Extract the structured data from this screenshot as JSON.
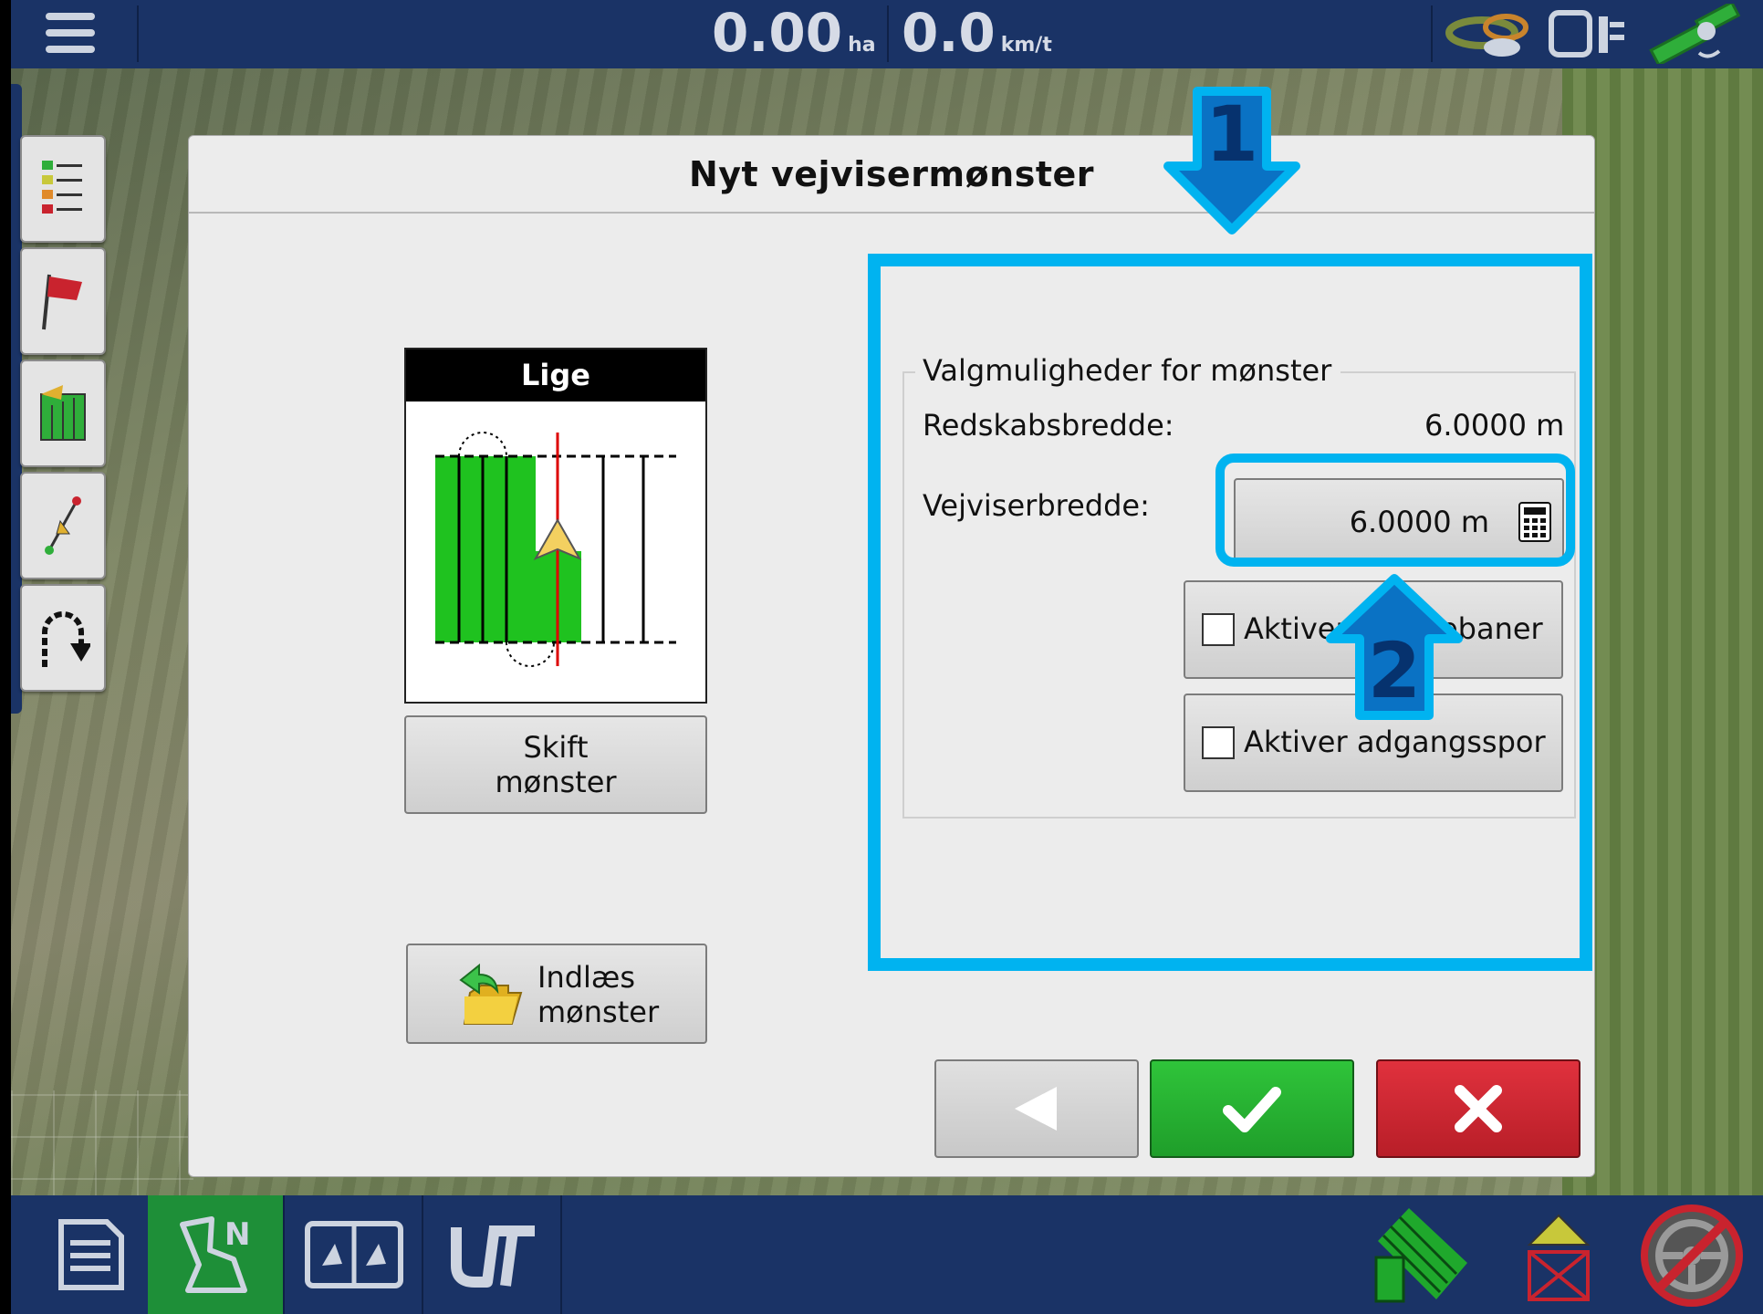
{
  "topbar": {
    "area_value": "0.00",
    "area_unit": "ha",
    "speed_value": "0.0",
    "speed_unit": "km/t"
  },
  "dialog": {
    "title": "Nyt vejvisermønster",
    "preview": {
      "header": "Lige"
    },
    "change_pattern_line1": "Skift",
    "change_pattern_line2": "mønster",
    "load_pattern_line1": "Indlæs",
    "load_pattern_line2": "mønster",
    "options": {
      "legend": "Valgmuligheder for mønster",
      "implement_width_label": "Redskabsbredde:",
      "implement_width_value": "6.0000 m",
      "guide_width_label": "Vejviserbredde:",
      "guide_width_value": "6.0000 m",
      "checkbox1_label": "Aktiver sprøjtebaner",
      "checkbox1_checked": false,
      "checkbox2_label": "Aktiver adgangsspor",
      "checkbox2_checked": false
    }
  },
  "callouts": {
    "one": "1",
    "two": "2"
  },
  "colors": {
    "accent": "#00b3f0",
    "ok": "#22a82e",
    "cancel": "#c9232e",
    "bar": "#1a3366"
  }
}
